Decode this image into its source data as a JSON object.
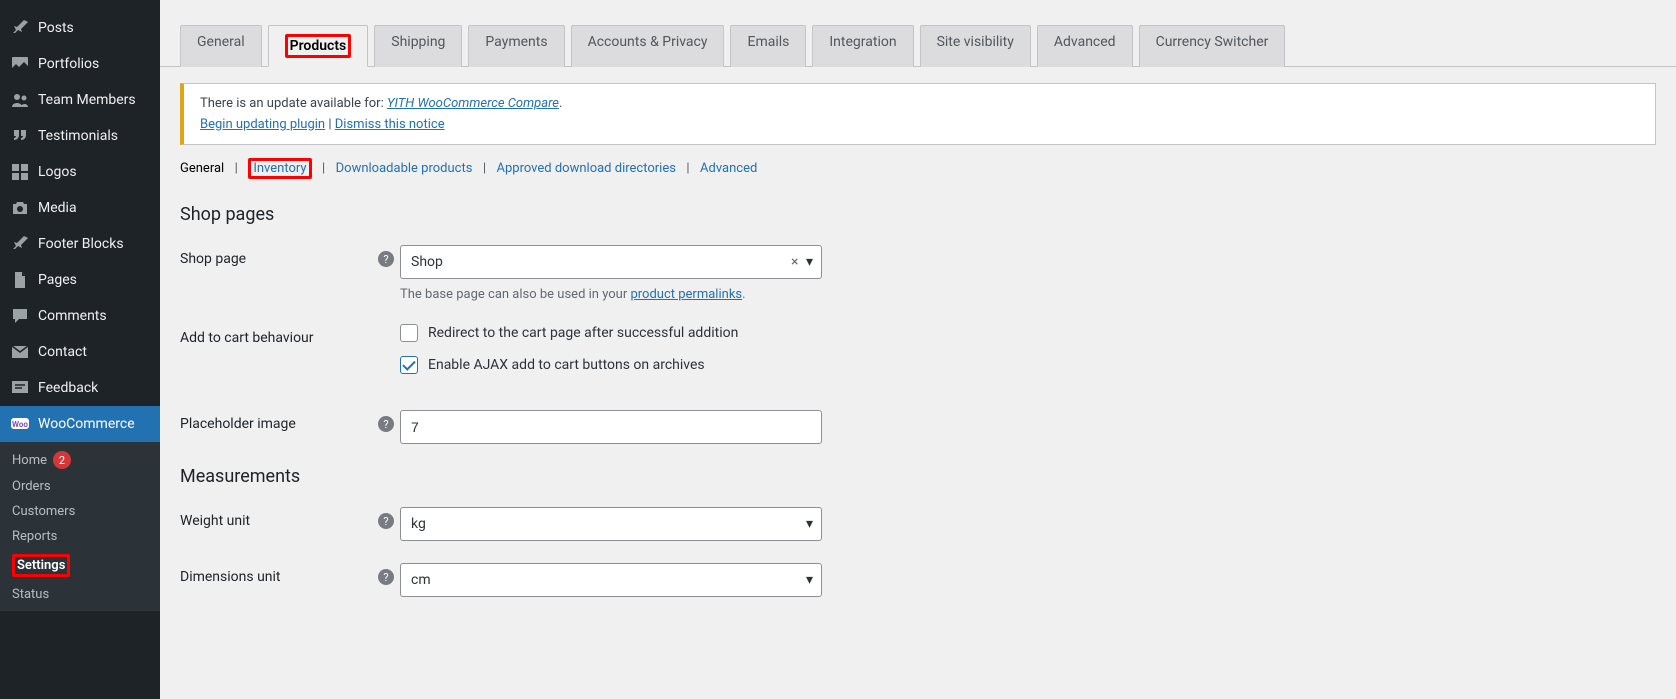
{
  "sidebar": {
    "items": [
      {
        "label": "Posts"
      },
      {
        "label": "Portfolios"
      },
      {
        "label": "Team Members"
      },
      {
        "label": "Testimonials"
      },
      {
        "label": "Logos"
      },
      {
        "label": "Media"
      },
      {
        "label": "Footer Blocks"
      },
      {
        "label": "Pages"
      },
      {
        "label": "Comments"
      },
      {
        "label": "Contact"
      },
      {
        "label": "Feedback"
      }
    ],
    "woocommerce": {
      "label": "WooCommerce",
      "sub": [
        {
          "label": "Home",
          "badge": "2"
        },
        {
          "label": "Orders"
        },
        {
          "label": "Customers"
        },
        {
          "label": "Reports"
        },
        {
          "label": "Settings"
        },
        {
          "label": "Status"
        }
      ]
    }
  },
  "tabs": [
    "General",
    "Products",
    "Shipping",
    "Payments",
    "Accounts & Privacy",
    "Emails",
    "Integration",
    "Site visibility",
    "Advanced",
    "Currency Switcher"
  ],
  "notice": {
    "prefix": "There is an update available for: ",
    "plugin": "YITH WooCommerce Compare",
    "dot": ".",
    "begin": "Begin updating plugin",
    "sep": " | ",
    "dismiss": "Dismiss this notice"
  },
  "subnav": {
    "current": "General",
    "inventory": "Inventory",
    "dl": "Downloadable products",
    "appr": "Approved download directories",
    "adv": "Advanced"
  },
  "sections": {
    "shop_pages": "Shop pages",
    "measurements": "Measurements"
  },
  "labels": {
    "shop_page": "Shop page",
    "shop_page_value": "Shop",
    "shop_page_desc_pre": "The base page can also be used in your ",
    "shop_page_desc_link": "product permalinks",
    "shop_page_desc_post": ".",
    "add_to_cart": "Add to cart behaviour",
    "chk_redirect": "Redirect to the cart page after successful addition",
    "chk_ajax": "Enable AJAX add to cart buttons on archives",
    "placeholder_image": "Placeholder image",
    "placeholder_value": "7",
    "weight_unit": "Weight unit",
    "weight_value": "kg",
    "dim_unit": "Dimensions unit",
    "dim_value": "cm"
  }
}
